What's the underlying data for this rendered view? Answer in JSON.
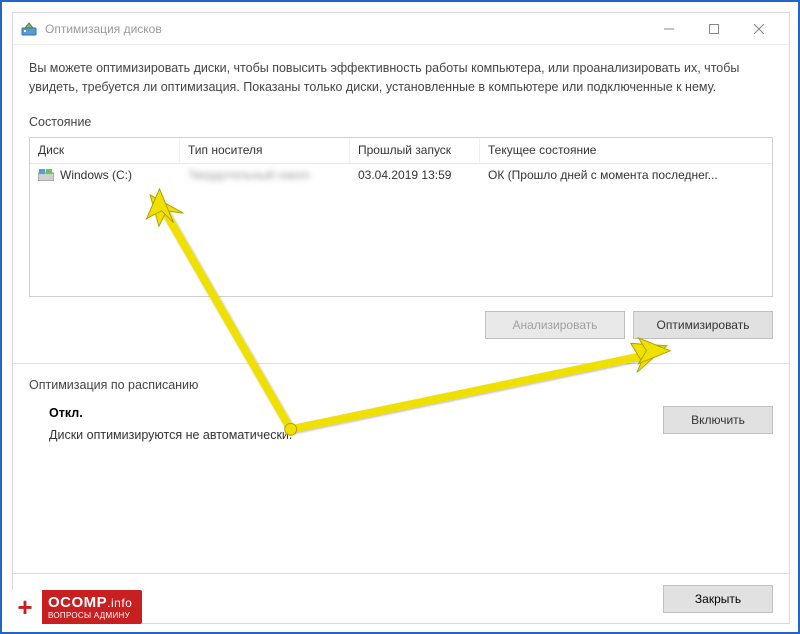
{
  "window": {
    "title": "Оптимизация дисков",
    "description": "Вы можете оптимизировать диски, чтобы повысить эффективность работы  компьютера, или проанализировать их, чтобы увидеть, требуется ли оптимизация. Показаны только диски, установленные в компьютере или подключенные к нему.",
    "status_label": "Состояние"
  },
  "table": {
    "headers": {
      "disk": "Диск",
      "media_type": "Тип носителя",
      "last_run": "Прошлый запуск",
      "current_status": "Текущее состояние"
    },
    "rows": [
      {
        "disk": "Windows (C:)",
        "media_type": "Твердотельный накоп",
        "last_run": "03.04.2019 13:59",
        "current_status": "ОК (Прошло дней с момента последнег..."
      }
    ]
  },
  "buttons": {
    "analyze": "Анализировать",
    "optimize": "Оптимизировать",
    "enable": "Включить",
    "close": "Закрыть"
  },
  "schedule": {
    "section_label": "Оптимизация по расписанию",
    "status": "Откл.",
    "description": "Диски оптимизируются не автоматически."
  },
  "watermark": {
    "brand": "OCOMP",
    "suffix": ".info",
    "tagline": "ВОПРОСЫ АДМИНУ"
  },
  "colors": {
    "arrow": "#f0e000",
    "arrow_stroke": "#b0a000",
    "outer_border": "#2166c6",
    "watermark_bg": "#c82020"
  }
}
